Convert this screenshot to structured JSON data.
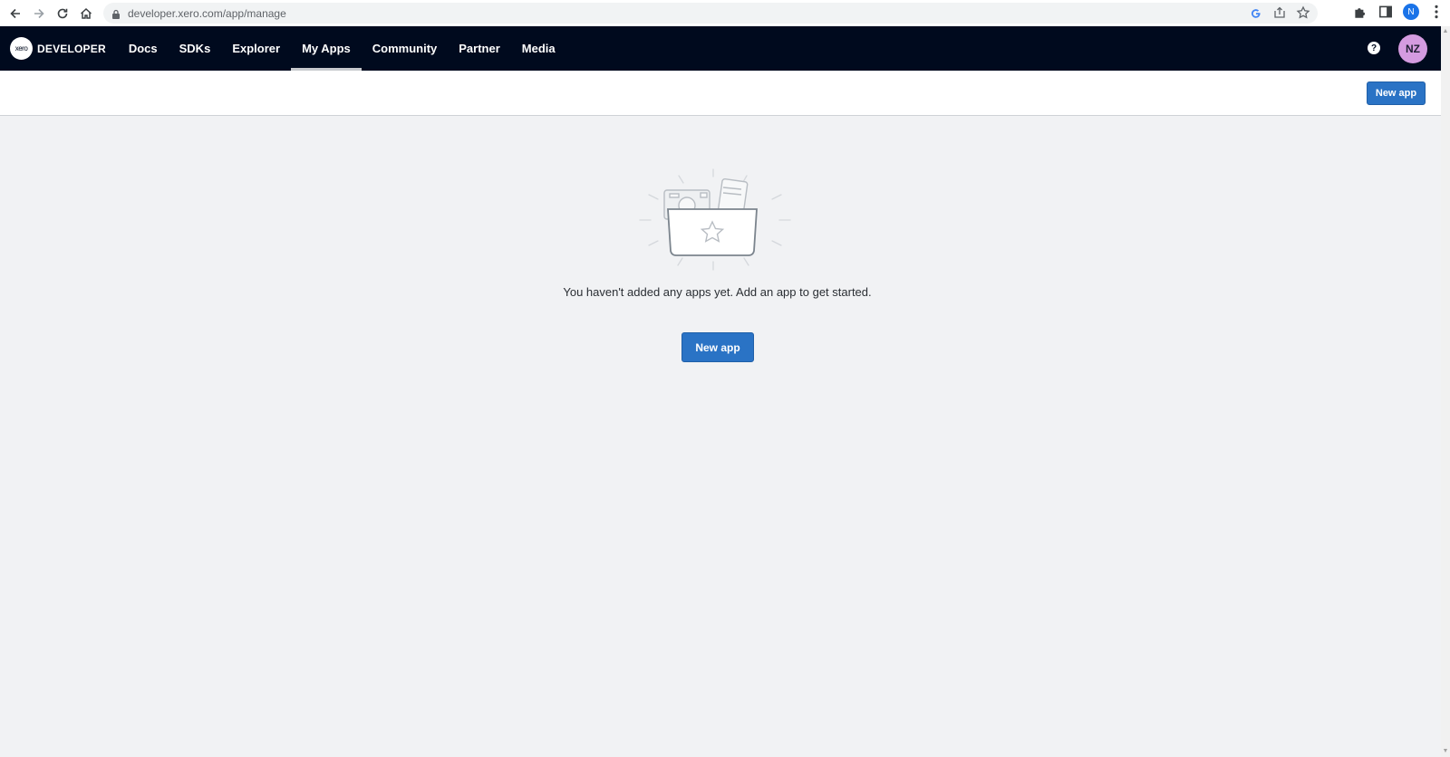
{
  "browser": {
    "url": "developer.xero.com/app/manage",
    "profile_initial": "N"
  },
  "header": {
    "logo_text": "xero",
    "brand": "DEVELOPER",
    "nav": [
      {
        "label": "Docs"
      },
      {
        "label": "SDKs"
      },
      {
        "label": "Explorer"
      },
      {
        "label": "My Apps",
        "active": true
      },
      {
        "label": "Community"
      },
      {
        "label": "Partner"
      },
      {
        "label": "Media"
      }
    ],
    "help_glyph": "?",
    "avatar_initials": "NZ"
  },
  "toolbar": {
    "new_app_label": "New app"
  },
  "empty_state": {
    "message": "You haven't added any apps yet. Add an app to get started.",
    "new_app_label": "New app"
  },
  "colors": {
    "nav_bg": "#000a1e",
    "primary_button": "#2a73c5",
    "avatar_bg": "#d49be0",
    "page_bg": "#f1f2f4"
  }
}
